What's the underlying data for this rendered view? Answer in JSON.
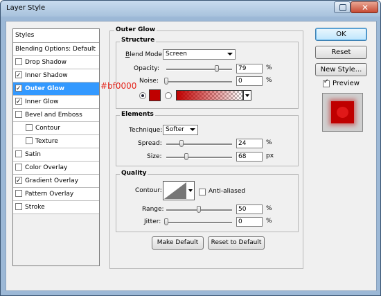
{
  "window": {
    "title": "Layer Style",
    "help_icon": "help-icon",
    "close_icon": "close-icon"
  },
  "styles_panel": {
    "header": "Styles",
    "items": [
      {
        "label": "Blending Options: Default",
        "checkbox": false,
        "checked": false,
        "selected": false
      },
      {
        "label": "Drop Shadow",
        "checkbox": true,
        "checked": false,
        "selected": false
      },
      {
        "label": "Inner Shadow",
        "checkbox": true,
        "checked": true,
        "selected": false
      },
      {
        "label": "Outer Glow",
        "checkbox": true,
        "checked": true,
        "selected": true
      },
      {
        "label": "Inner Glow",
        "checkbox": true,
        "checked": true,
        "selected": false
      },
      {
        "label": "Bevel and Emboss",
        "checkbox": true,
        "checked": false,
        "selected": false
      },
      {
        "label": "Contour",
        "checkbox": true,
        "checked": false,
        "selected": false,
        "sub": true
      },
      {
        "label": "Texture",
        "checkbox": true,
        "checked": false,
        "selected": false,
        "sub": true
      },
      {
        "label": "Satin",
        "checkbox": true,
        "checked": false,
        "selected": false
      },
      {
        "label": "Color Overlay",
        "checkbox": true,
        "checked": false,
        "selected": false
      },
      {
        "label": "Gradient Overlay",
        "checkbox": true,
        "checked": true,
        "selected": false
      },
      {
        "label": "Pattern Overlay",
        "checkbox": true,
        "checked": false,
        "selected": false
      },
      {
        "label": "Stroke",
        "checkbox": true,
        "checked": false,
        "selected": false
      }
    ]
  },
  "outer_glow": {
    "title": "Outer Glow",
    "structure": {
      "title": "Structure",
      "blend_mode_label": "Blend Mode:",
      "blend_mode_value": "Screen",
      "opacity_label": "Opacity:",
      "opacity_value": "79",
      "opacity_unit": "%",
      "noise_label": "Noise:",
      "noise_value": "0",
      "noise_unit": "%",
      "glow_color": "#bf0000",
      "color_annotation": "#bf0000"
    },
    "elements": {
      "title": "Elements",
      "technique_label": "Technique:",
      "technique_value": "Softer",
      "spread_label": "Spread:",
      "spread_value": "24",
      "spread_unit": "%",
      "size_label": "Size:",
      "size_value": "68",
      "size_unit": "px"
    },
    "quality": {
      "title": "Quality",
      "contour_label": "Contour:",
      "anti_aliased_label": "Anti-aliased",
      "range_label": "Range:",
      "range_value": "50",
      "range_unit": "%",
      "jitter_label": "Jitter:",
      "jitter_value": "0",
      "jitter_unit": "%"
    },
    "make_default_label": "Make Default",
    "reset_default_label": "Reset to Default"
  },
  "actions": {
    "ok_label": "OK",
    "reset_label": "Reset",
    "new_style_label": "New Style...",
    "preview_label": "Preview",
    "preview_checked": true
  },
  "colors": {
    "accent": "#3399ff",
    "glow": "#bf0000",
    "annotation": "#e4241b"
  }
}
